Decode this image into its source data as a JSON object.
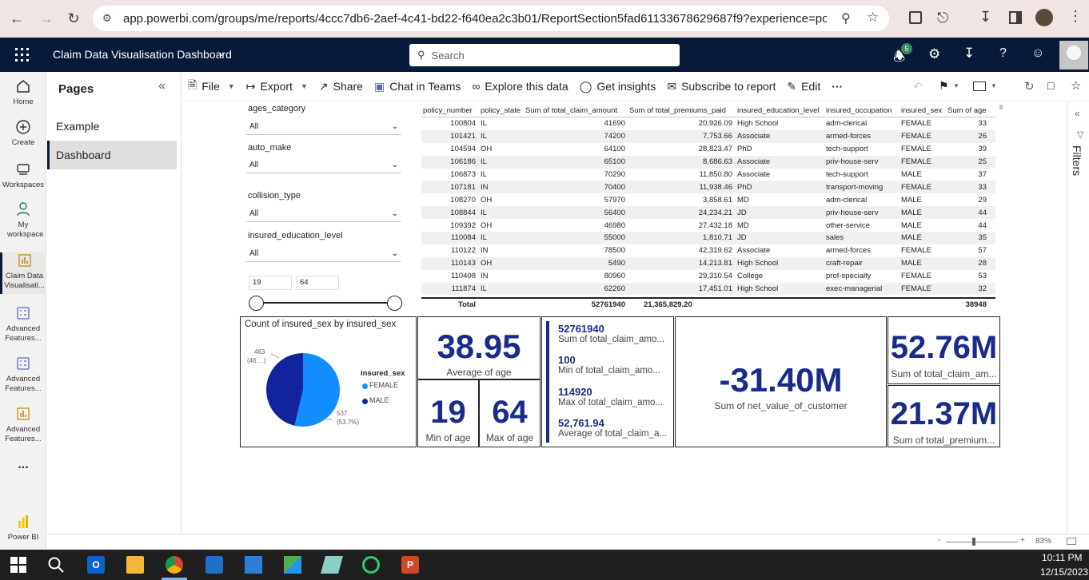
{
  "browser": {
    "url": "app.powerbi.com/groups/me/reports/4ccc7db6-2aef-4c41-bd22-f640ea2c3b01/ReportSection5fad61133678629687f9?experience=power-bi"
  },
  "header": {
    "title": "Claim Data Visualisation Dashboard",
    "search_placeholder": "Search",
    "notification_count": "5"
  },
  "rail": {
    "items": [
      {
        "label": "Home",
        "icon": "home-icon"
      },
      {
        "label": "Create",
        "icon": "plus-circle-icon"
      },
      {
        "label": "Workspaces",
        "icon": "workspaces-icon"
      },
      {
        "label": "My workspace",
        "icon": "person-icon"
      },
      {
        "label": "Claim Data Visualisati...",
        "icon": "report-icon"
      },
      {
        "label": "Advanced Features...",
        "icon": "dashboard-icon"
      },
      {
        "label": "Advanced Features...",
        "icon": "dashboard-icon"
      },
      {
        "label": "Advanced Features...",
        "icon": "report-icon"
      }
    ],
    "more": "...",
    "brand": "Power BI"
  },
  "pages": {
    "title": "Pages",
    "items": [
      "Example",
      "Dashboard"
    ],
    "selected": "Dashboard"
  },
  "toolbar": {
    "file": "File",
    "export": "Export",
    "share": "Share",
    "chat": "Chat in Teams",
    "explore": "Explore this data",
    "insights": "Get insights",
    "subscribe": "Subscribe to report",
    "edit": "Edit",
    "more": "···"
  },
  "filters_label": "Filters",
  "slicers": {
    "ages_category": {
      "label": "ages_category",
      "value": "All"
    },
    "auto_make": {
      "label": "auto_make",
      "value": "All"
    },
    "collision_type": {
      "label": "collision_type",
      "value": "All"
    },
    "insured_education_level": {
      "label": "insured_education_level",
      "value": "All"
    },
    "age_range": {
      "min": "19",
      "max": "64"
    }
  },
  "table": {
    "headers": [
      "policy_number",
      "policy_state",
      "Sum of total_claim_amount",
      "Sum of total_premiums_paid",
      "insured_education_level",
      "insured_occupation",
      "insured_sex",
      "Sum of age"
    ],
    "rows": [
      [
        "100804",
        "IL",
        "41690",
        "20,926.09",
        "High School",
        "adm-clerical",
        "FEMALE",
        "33"
      ],
      [
        "101421",
        "IL",
        "74200",
        "7,753.66",
        "Associate",
        "armed-forces",
        "FEMALE",
        "26"
      ],
      [
        "104594",
        "OH",
        "64100",
        "28,823.47",
        "PhD",
        "tech-support",
        "FEMALE",
        "39"
      ],
      [
        "106186",
        "IL",
        "65100",
        "8,686.63",
        "Associate",
        "priv-house-serv",
        "FEMALE",
        "25"
      ],
      [
        "106873",
        "IL",
        "70290",
        "11,850.80",
        "Associate",
        "tech-support",
        "MALE",
        "37"
      ],
      [
        "107181",
        "IN",
        "70400",
        "11,938.46",
        "PhD",
        "transport-moving",
        "FEMALE",
        "33"
      ],
      [
        "108270",
        "OH",
        "57970",
        "3,858.61",
        "MD",
        "adm-clerical",
        "MALE",
        "29"
      ],
      [
        "108844",
        "IL",
        "56400",
        "24,234.21",
        "JD",
        "priv-house-serv",
        "MALE",
        "44"
      ],
      [
        "109392",
        "OH",
        "46980",
        "27,432.18",
        "MD",
        "other-service",
        "MALE",
        "44"
      ],
      [
        "110084",
        "IL",
        "55000",
        "1,810.71",
        "JD",
        "sales",
        "MALE",
        "35"
      ],
      [
        "110122",
        "IN",
        "78500",
        "42,319.62",
        "Associate",
        "armed-forces",
        "FEMALE",
        "57"
      ],
      [
        "110143",
        "OH",
        "5490",
        "14,213.81",
        "High School",
        "craft-repair",
        "MALE",
        "28"
      ],
      [
        "110408",
        "IN",
        "80960",
        "29,310.54",
        "College",
        "prof-specialty",
        "FEMALE",
        "53"
      ],
      [
        "111874",
        "IL",
        "62260",
        "17,451.01",
        "High School",
        "exec-managerial",
        "FEMALE",
        "32"
      ]
    ],
    "total": {
      "label": "Total",
      "claim": "52761940",
      "premiums": "21,365,829.20",
      "age": "38948"
    }
  },
  "chart_data": {
    "type": "pie",
    "title": "Count of insured_sex by insured_sex",
    "legend_title": "insured_sex",
    "categories": [
      "FEMALE",
      "MALE"
    ],
    "values": [
      537,
      463
    ],
    "percent_labels": [
      "537 (53.7%)",
      "463 (46....)"
    ],
    "colors": [
      "#118dff",
      "#12239e"
    ],
    "legend_position": "right"
  },
  "cards": {
    "avg_age": {
      "value": "38.95",
      "caption": "Average of age"
    },
    "min_age": {
      "value": "19",
      "caption": "Min of age"
    },
    "max_age": {
      "value": "64",
      "caption": "Max of age"
    },
    "multi": [
      {
        "value": "52761940",
        "caption": "Sum of total_claim_amo..."
      },
      {
        "value": "100",
        "caption": "Min of total_claim_amo..."
      },
      {
        "value": "114920",
        "caption": "Max of total_claim_amo..."
      },
      {
        "value": "52,761.94",
        "caption": "Average of total_claim_a..."
      }
    ],
    "net_value": {
      "value": "-31.40M",
      "caption": "Sum of net_value_of_customer"
    },
    "sum_claim": {
      "value": "52.76M",
      "caption": "Sum of total_claim_am..."
    },
    "sum_premium": {
      "value": "21.37M",
      "caption": "Sum of total_premium..."
    }
  },
  "status": {
    "zoom": "83%",
    "minus": "-",
    "plus": "+"
  },
  "taskbar": {
    "time": "10:11 PM",
    "date": "12/15/2023"
  }
}
